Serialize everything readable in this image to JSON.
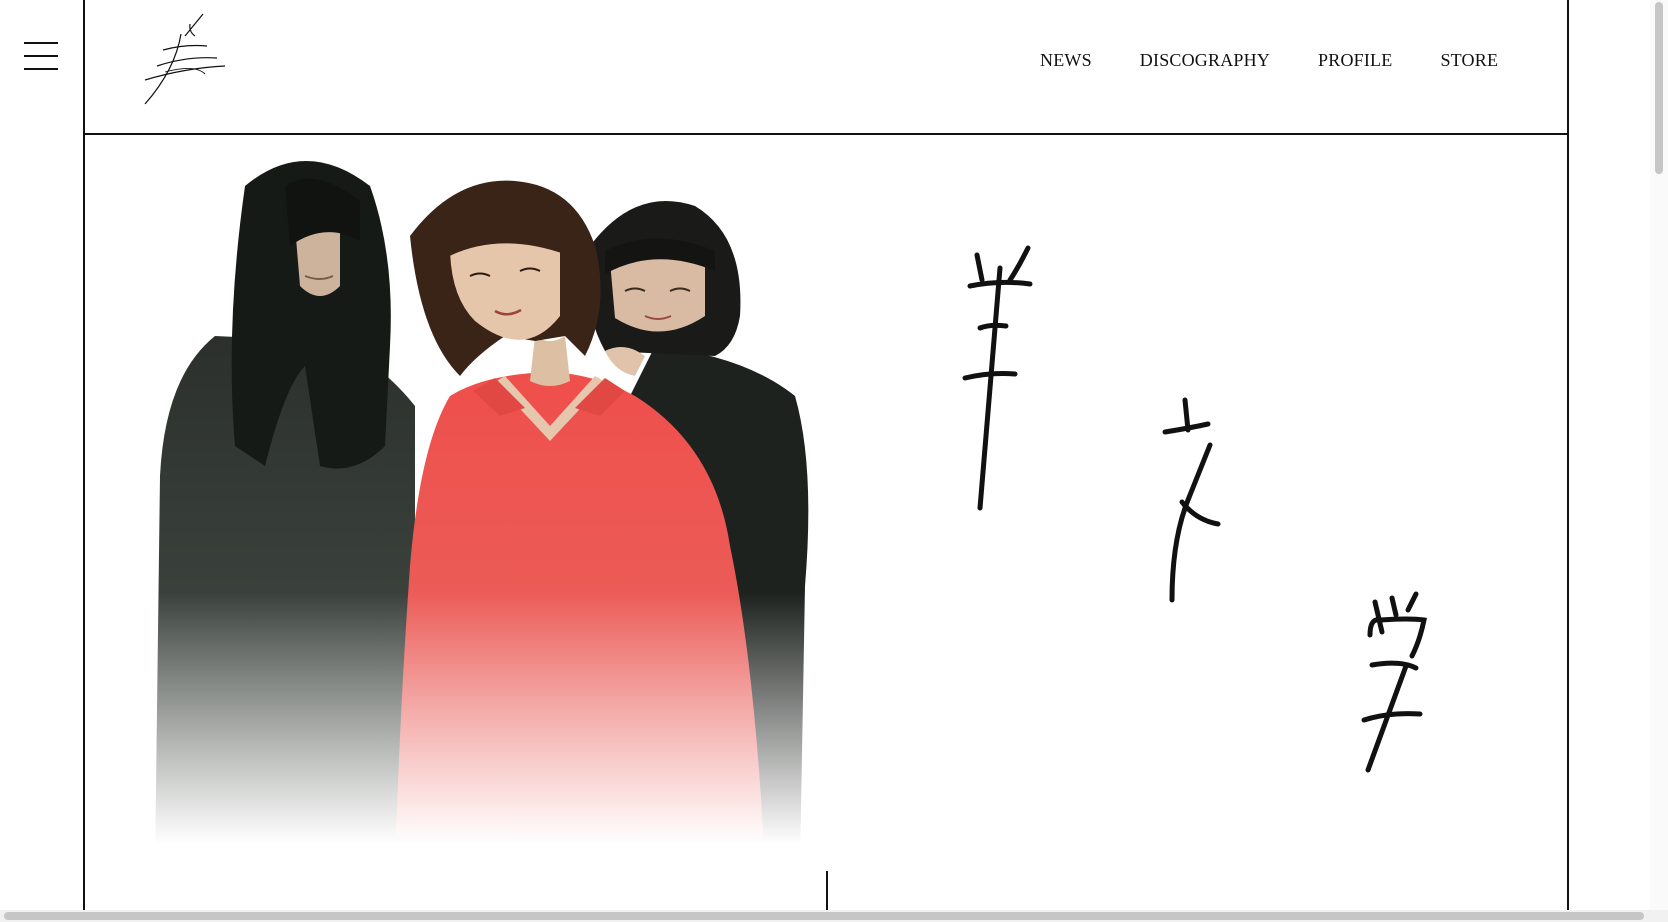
{
  "menu": {
    "icon": "hamburger-menu-icon"
  },
  "logo": {
    "icon": "band-signature-logo"
  },
  "nav": {
    "items": [
      {
        "label": "NEWS"
      },
      {
        "label": "DISCOGRAPHY"
      },
      {
        "label": "PROFILE"
      },
      {
        "label": "STORE"
      }
    ]
  },
  "hero": {
    "photo": "band-members-photo",
    "calligraphy": "band-name-calligraphy-art",
    "scroll_indicator": "scroll-down-line-icon"
  },
  "colors": {
    "frame": "#111111",
    "background": "#ffffff",
    "accent_red": "#e8504e",
    "dark_clothing": "#2a2f2a"
  }
}
